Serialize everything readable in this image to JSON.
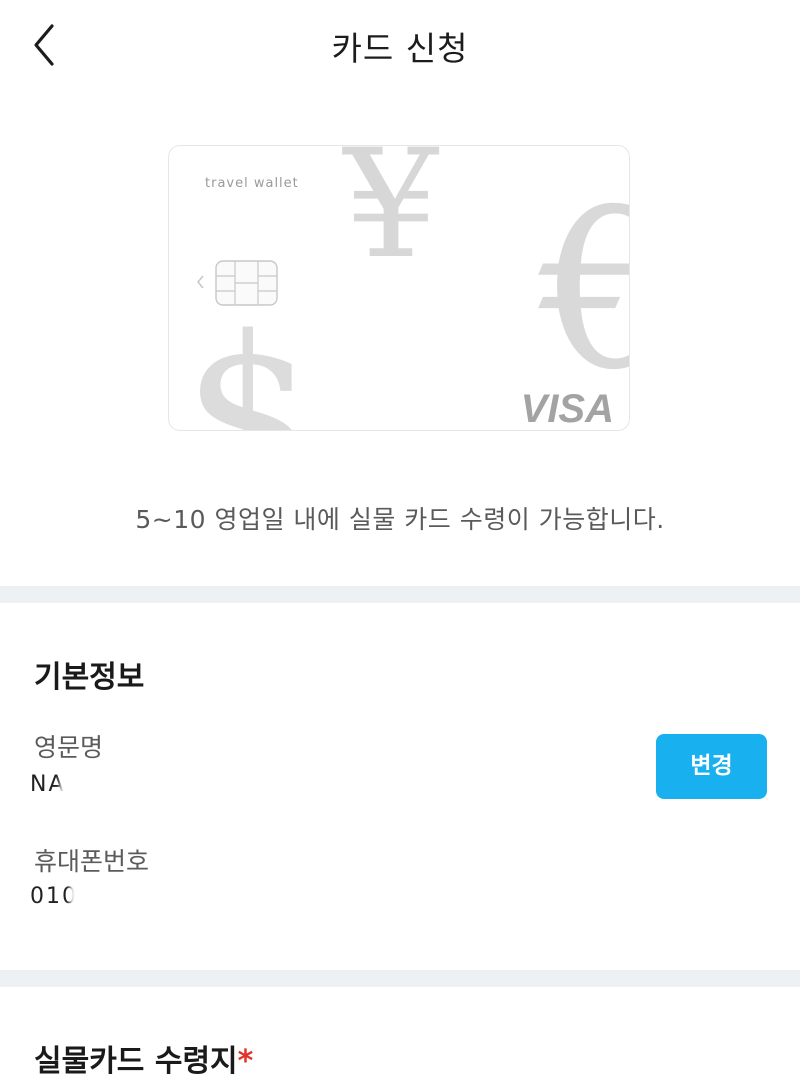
{
  "header": {
    "title": "카드 신청",
    "back_icon": "chevron-left-icon"
  },
  "card": {
    "brand_text": "travel wallet",
    "network": "VISA",
    "currency_symbols": [
      "¥",
      "€",
      "$"
    ]
  },
  "subtitle": "5~10 영업일 내에 실물 카드 수령이 가능합니다.",
  "basic_info": {
    "title": "기본정보",
    "english_name_label": "영문명",
    "english_name_value": "NA",
    "phone_label": "휴대폰번호",
    "phone_value": "010",
    "change_button": "변경"
  },
  "delivery": {
    "title": "실물카드 수령지",
    "required_mark": "*"
  },
  "colors": {
    "accent": "#19b0ef",
    "required": "#e2332b",
    "divider": "#eef1f4"
  }
}
